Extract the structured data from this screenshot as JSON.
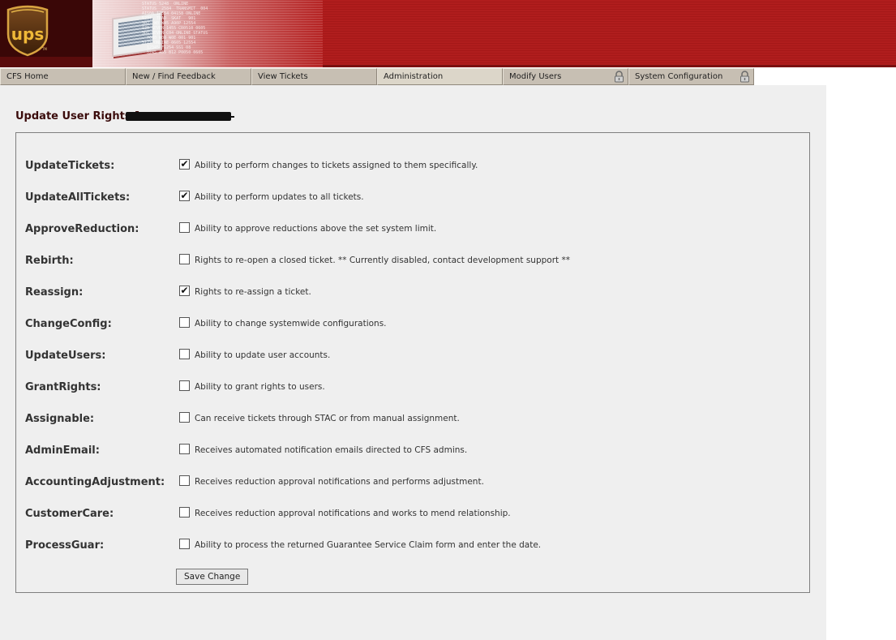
{
  "header": {
    "logo_text": "UPS",
    "banner_text": "STATUS 5248  ONLINE\nSTATUS  2584  TRANSMIT  004\nAIS0A 12554 04158 ONLINE\n5234  TRAD  SKAT   901\nS02  W0 W45 A90P 12554\n120 SEVEN 1455 CR0510 0605\nSD1 SEVEN C04 ONLINE STATUS\n  7000 W08 W0E 001 901\n5123 ONLINE 0605 12554\n  12345 F1254 SS1 08\n  5245 A55 B12 P0050 0605"
  },
  "nav": {
    "tabs": [
      {
        "label": "CFS Home",
        "active": false,
        "locked": false
      },
      {
        "label": "New / Find Feedback",
        "active": false,
        "locked": false
      },
      {
        "label": "View Tickets",
        "active": false,
        "locked": false
      },
      {
        "label": "Administration",
        "active": true,
        "locked": false
      },
      {
        "label": "Modify Users",
        "active": false,
        "locked": true
      },
      {
        "label": "System Configuration",
        "active": false,
        "locked": true
      }
    ]
  },
  "page": {
    "title": "Update User Rights ["
  },
  "rights": [
    {
      "label": "UpdateTickets:",
      "checked": true,
      "description": "Ability to perform changes to tickets assigned to them specifically."
    },
    {
      "label": "UpdateAllTickets:",
      "checked": true,
      "description": "Ability to perform updates to all tickets."
    },
    {
      "label": "ApproveReduction:",
      "checked": false,
      "description": "Ability to approve reductions above the set system limit."
    },
    {
      "label": "Rebirth:",
      "checked": false,
      "description": "Rights to re-open a closed ticket. ** Currently disabled, contact development support **"
    },
    {
      "label": "Reassign:",
      "checked": true,
      "description": "Rights to re-assign a ticket."
    },
    {
      "label": "ChangeConfig:",
      "checked": false,
      "description": "Ability to change systemwide configurations."
    },
    {
      "label": "UpdateUsers:",
      "checked": false,
      "description": "Ability to update user accounts."
    },
    {
      "label": "GrantRights:",
      "checked": false,
      "description": "Ability to grant rights to users."
    },
    {
      "label": "Assignable:",
      "checked": false,
      "description": "Can receive tickets through STAC or from manual assignment."
    },
    {
      "label": "AdminEmail:",
      "checked": false,
      "description": "Receives automated notification emails directed to CFS admins."
    },
    {
      "label": "AccountingAdjustment:",
      "checked": false,
      "description": "Receives reduction approval notifications and performs adjustment."
    },
    {
      "label": "CustomerCare:",
      "checked": false,
      "description": "Receives reduction approval notifications and works to mend relationship."
    },
    {
      "label": "ProcessGuar:",
      "checked": false,
      "description": "Ability to process the returned Guarantee Service Claim form and enter the date."
    }
  ],
  "form": {
    "save_label": "Save Change"
  },
  "colors": {
    "header_red": "#b01d1d",
    "tab_bg": "#c7bfb3",
    "panel_bg": "#efefef",
    "title_color": "#3a0b0b"
  }
}
